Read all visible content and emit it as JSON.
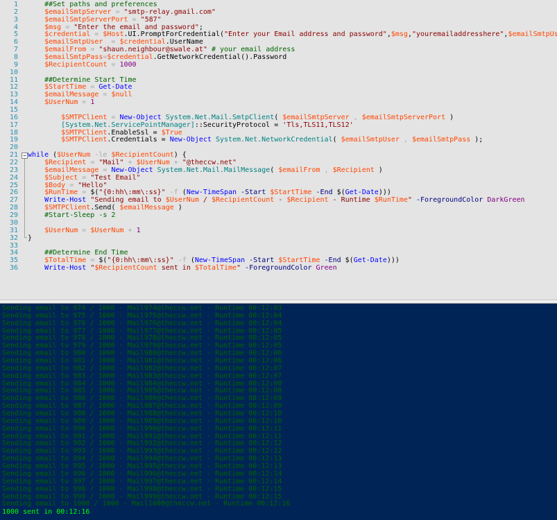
{
  "editor": {
    "line_numbers": [
      "1",
      "2",
      "3",
      "4",
      "5",
      "6",
      "7",
      "8",
      "9",
      "10",
      "11",
      "12",
      "13",
      "14",
      "15",
      "16",
      "17",
      "18",
      "19",
      "20",
      "21",
      "22",
      "23",
      "24",
      "25",
      "26",
      "27",
      "28",
      "29",
      "30",
      "31",
      "32",
      "33",
      "34",
      "35",
      "36"
    ],
    "lines": [
      [
        [
          "    ##Set paths and preferences",
          "cm"
        ]
      ],
      [
        [
          "    ",
          "pl"
        ],
        [
          "$emailSmtpServer",
          "vr"
        ],
        [
          " = ",
          "op"
        ],
        [
          "\"smtp-relay.gmail.com\"",
          "st"
        ]
      ],
      [
        [
          "    ",
          "pl"
        ],
        [
          "$emailSmtpServerPort",
          "vr"
        ],
        [
          " = ",
          "op"
        ],
        [
          "\"587\"",
          "st"
        ]
      ],
      [
        [
          "    ",
          "pl"
        ],
        [
          "$msg",
          "vr"
        ],
        [
          " = ",
          "op"
        ],
        [
          "\"Enter the email and password\"",
          "st"
        ],
        [
          ";",
          "pl"
        ]
      ],
      [
        [
          "    ",
          "pl"
        ],
        [
          "$credential",
          "vr"
        ],
        [
          " = ",
          "op"
        ],
        [
          "$Host",
          "vr"
        ],
        [
          ".UI.PromptForCredential(",
          "pl"
        ],
        [
          "\"Enter your Email address and password\"",
          "st"
        ],
        [
          ",",
          "pl"
        ],
        [
          "$msg",
          "vr"
        ],
        [
          ",",
          "pl"
        ],
        [
          "\"youremailaddresshere\"",
          "st"
        ],
        [
          ",",
          "pl"
        ],
        [
          "$emailSmtpUser",
          "vr"
        ],
        [
          ")",
          "pl"
        ]
      ],
      [
        [
          "    ",
          "pl"
        ],
        [
          "$emailSmtpUser",
          "vr"
        ],
        [
          "  = ",
          "op"
        ],
        [
          "$credential",
          "vr"
        ],
        [
          ".UserName",
          "pl"
        ]
      ],
      [
        [
          "    ",
          "pl"
        ],
        [
          "$emailFrom",
          "vr"
        ],
        [
          " = ",
          "op"
        ],
        [
          "\"shaun.neighbour@swale.at\"",
          "st"
        ],
        [
          " # your email address",
          "cm"
        ]
      ],
      [
        [
          "    ",
          "pl"
        ],
        [
          "$emailSmtpPass",
          "vr"
        ],
        [
          "=",
          "op"
        ],
        [
          "$credential",
          "vr"
        ],
        [
          ".GetNetworkCredential().Password",
          "pl"
        ]
      ],
      [
        [
          "    ",
          "pl"
        ],
        [
          "$RecipientCount",
          "vr"
        ],
        [
          " = ",
          "op"
        ],
        [
          "1000",
          "nm"
        ]
      ],
      [
        [
          "",
          "pl"
        ]
      ],
      [
        [
          "    ##Determine Start Time",
          "cm"
        ]
      ],
      [
        [
          "    ",
          "pl"
        ],
        [
          "$StartTime",
          "vr"
        ],
        [
          " = ",
          "op"
        ],
        [
          "Get-Date",
          "cd"
        ]
      ],
      [
        [
          "    ",
          "pl"
        ],
        [
          "$emailMessage",
          "vr"
        ],
        [
          " = ",
          "op"
        ],
        [
          "$null",
          "vr"
        ]
      ],
      [
        [
          "    ",
          "pl"
        ],
        [
          "$UserNum",
          "vr"
        ],
        [
          " = ",
          "op"
        ],
        [
          "1",
          "nm"
        ]
      ],
      [
        [
          "",
          "pl"
        ]
      ],
      [
        [
          "        ",
          "pl"
        ],
        [
          "$SMTPClient",
          "vr"
        ],
        [
          " = ",
          "op"
        ],
        [
          "New-Object",
          "cd"
        ],
        [
          " System.Net.Mail.SmtpClient",
          "tp"
        ],
        [
          "( ",
          "pl"
        ],
        [
          "$emailSmtpServer",
          "vr"
        ],
        [
          " , ",
          "op"
        ],
        [
          "$emailSmtpServerPort",
          "vr"
        ],
        [
          " )",
          "pl"
        ]
      ],
      [
        [
          "        ",
          "pl"
        ],
        [
          "[System.Net.ServicePointManager]",
          "tp"
        ],
        [
          "::SecurityProtocol = ",
          "pl"
        ],
        [
          "'Tls,TLS11,TLS12'",
          "st"
        ]
      ],
      [
        [
          "        ",
          "pl"
        ],
        [
          "$SMTPClient",
          "vr"
        ],
        [
          ".EnableSsl = ",
          "pl"
        ],
        [
          "$True",
          "vr"
        ]
      ],
      [
        [
          "        ",
          "pl"
        ],
        [
          "$SMTPClient",
          "vr"
        ],
        [
          ".Credentials = ",
          "pl"
        ],
        [
          "New-Object",
          "cd"
        ],
        [
          " System.Net.NetworkCredential",
          "tp"
        ],
        [
          "( ",
          "pl"
        ],
        [
          "$emailSmtpUser",
          "vr"
        ],
        [
          " , ",
          "op"
        ],
        [
          "$emailSmtpPass",
          "vr"
        ],
        [
          " );",
          "pl"
        ]
      ],
      [
        [
          "",
          "pl"
        ]
      ],
      [
        [
          "while",
          "cd"
        ],
        [
          " (",
          "pl"
        ],
        [
          "$UserNum",
          "vr"
        ],
        [
          " -le ",
          "op"
        ],
        [
          "$RecipientCount",
          "vr"
        ],
        [
          ") {",
          "pl"
        ]
      ],
      [
        [
          "    ",
          "pl"
        ],
        [
          "$Recipient",
          "vr"
        ],
        [
          " = ",
          "op"
        ],
        [
          "\"Mail\"",
          "st"
        ],
        [
          " + ",
          "op"
        ],
        [
          "$UserNum",
          "vr"
        ],
        [
          " + ",
          "op"
        ],
        [
          "\"@theccw.net\"",
          "st"
        ]
      ],
      [
        [
          "    ",
          "pl"
        ],
        [
          "$emailMessage",
          "vr"
        ],
        [
          " = ",
          "op"
        ],
        [
          "New-Object",
          "cd"
        ],
        [
          " System.Net.Mail.MailMessage",
          "tp"
        ],
        [
          "( ",
          "pl"
        ],
        [
          "$emailFrom",
          "vr"
        ],
        [
          " , ",
          "op"
        ],
        [
          "$Recipient",
          "vr"
        ],
        [
          " )",
          "pl"
        ]
      ],
      [
        [
          "    ",
          "pl"
        ],
        [
          "$Subject",
          "vr"
        ],
        [
          " = ",
          "op"
        ],
        [
          "\"Test Email\"",
          "st"
        ]
      ],
      [
        [
          "    ",
          "pl"
        ],
        [
          "$Body",
          "vr"
        ],
        [
          " = ",
          "op"
        ],
        [
          "\"Hello\"",
          "st"
        ]
      ],
      [
        [
          "    ",
          "pl"
        ],
        [
          "$RunTime",
          "vr"
        ],
        [
          " = ",
          "op"
        ],
        [
          "$(",
          "pl"
        ],
        [
          "\"{0:hh\\:mm\\:ss}\"",
          "st"
        ],
        [
          " -f ",
          "op"
        ],
        [
          "(",
          "pl"
        ],
        [
          "New-TimeSpan",
          "cd"
        ],
        [
          " -Start ",
          "pm"
        ],
        [
          "$StartTime",
          "vr"
        ],
        [
          " -End ",
          "pm"
        ],
        [
          "$(",
          "pl"
        ],
        [
          "Get-Date",
          "cd"
        ],
        [
          ")))",
          "pl"
        ]
      ],
      [
        [
          "    ",
          "pl"
        ],
        [
          "Write-Host",
          "cd"
        ],
        [
          " \"Sending email to ",
          "st"
        ],
        [
          "$UserNum",
          "vr"
        ],
        [
          " / ",
          "st"
        ],
        [
          "$RecipientCount",
          "vr"
        ],
        [
          " - ",
          "st"
        ],
        [
          "$Recipient",
          "vr"
        ],
        [
          " - Runtime ",
          "st"
        ],
        [
          "$RunTime",
          "vr"
        ],
        [
          "\"",
          "st"
        ],
        [
          " -ForegroundColor ",
          "pm"
        ],
        [
          "DarkGreen",
          "nm"
        ]
      ],
      [
        [
          "    ",
          "pl"
        ],
        [
          "$SMTPClient",
          "vr"
        ],
        [
          ".Send( ",
          "pl"
        ],
        [
          "$emailMessage",
          "vr"
        ],
        [
          " )",
          "pl"
        ]
      ],
      [
        [
          "    #Start-Sleep -s 2",
          "cm"
        ]
      ],
      [
        [
          "",
          "pl"
        ]
      ],
      [
        [
          "    ",
          "pl"
        ],
        [
          "$UserNum",
          "vr"
        ],
        [
          " = ",
          "op"
        ],
        [
          "$UserNum",
          "vr"
        ],
        [
          " + ",
          "op"
        ],
        [
          "1",
          "nm"
        ]
      ],
      [
        [
          "}",
          "pl"
        ]
      ],
      [
        [
          "",
          "pl"
        ]
      ],
      [
        [
          "    ##Determine End Time",
          "cm"
        ]
      ],
      [
        [
          "    ",
          "pl"
        ],
        [
          "$TotalTime",
          "vr"
        ],
        [
          " = ",
          "op"
        ],
        [
          "$(",
          "pl"
        ],
        [
          "\"{0:hh\\:mm\\:ss}\"",
          "st"
        ],
        [
          " -f ",
          "op"
        ],
        [
          "(",
          "pl"
        ],
        [
          "New-TimeSpan",
          "cd"
        ],
        [
          " -Start ",
          "pm"
        ],
        [
          "$StartTime",
          "vr"
        ],
        [
          " -End ",
          "pm"
        ],
        [
          "$(",
          "pl"
        ],
        [
          "Get-Date",
          "cd"
        ],
        [
          ")))",
          "pl"
        ]
      ],
      [
        [
          "    ",
          "pl"
        ],
        [
          "Write-Host",
          "cd"
        ],
        [
          " \"",
          "st"
        ],
        [
          "$RecipientCount",
          "vr"
        ],
        [
          " sent in ",
          "st"
        ],
        [
          "$TotalTime",
          "vr"
        ],
        [
          "\"",
          "st"
        ],
        [
          " -ForegroundColor ",
          "pm"
        ],
        [
          "Green",
          "nm"
        ]
      ]
    ]
  },
  "console": {
    "lines": [
      "Sending email to 974 / 1000 - Mail974@theccw.net - Runtime 00:12:03",
      "Sending email to 975 / 1000 - Mail975@theccw.net - Runtime 00:12:04",
      "Sending email to 976 / 1000 - Mail976@theccw.net - Runtime 00:12:04",
      "Sending email to 977 / 1000 - Mail977@theccw.net - Runtime 00:12:05",
      "Sending email to 978 / 1000 - Mail978@theccw.net - Runtime 00:12:05",
      "Sending email to 979 / 1000 - Mail979@theccw.net - Runtime 00:12:05",
      "Sending email to 980 / 1000 - Mail980@theccw.net - Runtime 00:12:06",
      "Sending email to 981 / 1000 - Mail981@theccw.net - Runtime 00:12:06",
      "Sending email to 982 / 1000 - Mail982@theccw.net - Runtime 00:12:07",
      "Sending email to 983 / 1000 - Mail983@theccw.net - Runtime 00:12:07",
      "Sending email to 984 / 1000 - Mail984@theccw.net - Runtime 00:12:08",
      "Sending email to 985 / 1000 - Mail985@theccw.net - Runtime 00:12:08",
      "Sending email to 986 / 1000 - Mail986@theccw.net - Runtime 00:12:09",
      "Sending email to 987 / 1000 - Mail987@theccw.net - Runtime 00:12:09",
      "Sending email to 988 / 1000 - Mail988@theccw.net - Runtime 00:12:10",
      "Sending email to 989 / 1000 - Mail989@theccw.net - Runtime 00:12:10",
      "Sending email to 990 / 1000 - Mail990@theccw.net - Runtime 00:12:11",
      "Sending email to 991 / 1000 - Mail991@theccw.net - Runtime 00:12:11",
      "Sending email to 992 / 1000 - Mail992@theccw.net - Runtime 00:12:12",
      "Sending email to 993 / 1000 - Mail993@theccw.net - Runtime 00:12:12",
      "Sending email to 994 / 1000 - Mail994@theccw.net - Runtime 00:12:13",
      "Sending email to 995 / 1000 - Mail995@theccw.net - Runtime 00:12:13",
      "Sending email to 996 / 1000 - Mail996@theccw.net - Runtime 00:12:14",
      "Sending email to 997 / 1000 - Mail997@theccw.net - Runtime 00:12:14",
      "Sending email to 998 / 1000 - Mail998@theccw.net - Runtime 00:12:15",
      "Sending email to 999 / 1000 - Mail999@theccw.net - Runtime 00:12:15",
      "Sending email to 1000 / 1000 - Mail1000@theccw.net - Runtime 00:12:16"
    ],
    "final_line": "1000 sent in 00:12:16",
    "line_color": "#006400",
    "final_color": "#00ff00",
    "background": "#012456"
  }
}
